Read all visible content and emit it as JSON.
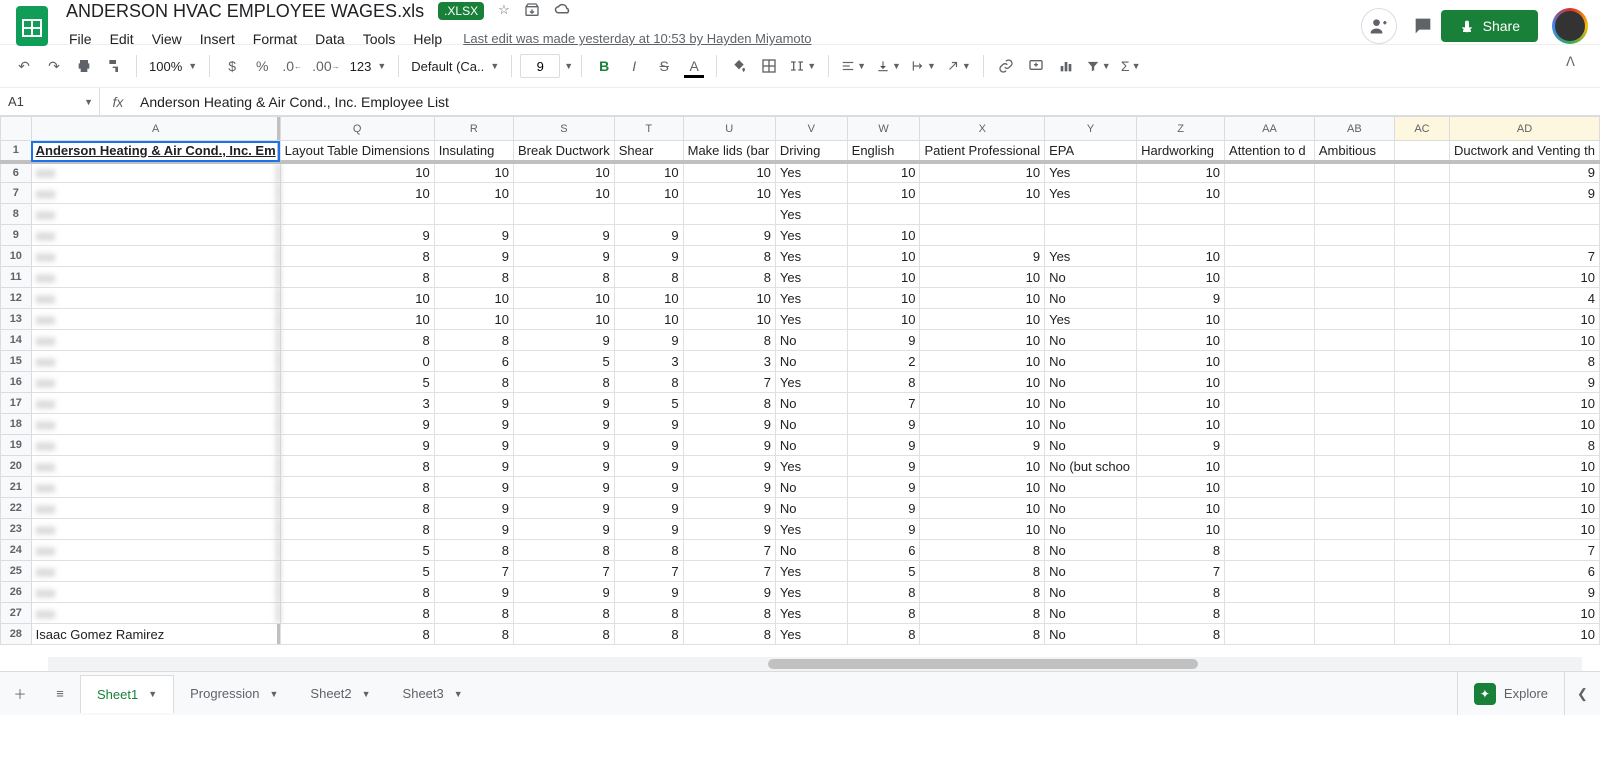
{
  "doc": {
    "title": "ANDERSON HVAC EMPLOYEE WAGES.xls",
    "badge": ".XLSX",
    "lastEdit": "Last edit was made yesterday at 10:53 by Hayden Miyamoto"
  },
  "menu": [
    "File",
    "Edit",
    "View",
    "Insert",
    "Format",
    "Data",
    "Tools",
    "Help"
  ],
  "toolbar": {
    "zoom": "100%",
    "numfmt": "123",
    "font": "Default (Ca...",
    "size": "9"
  },
  "share": "Share",
  "fx": {
    "namebox": "A1",
    "formula": "Anderson Heating & Air Cond., Inc. Employee List"
  },
  "cols": [
    {
      "letter": "A",
      "label": "Anderson Heating & Air Cond., Inc. Em",
      "cls": "frozen-a",
      "hcls": "head1"
    },
    {
      "letter": "Q",
      "label": "Layout Table Dimensions"
    },
    {
      "letter": "R",
      "label": "Insulating"
    },
    {
      "letter": "S",
      "label": "Break Ductwork"
    },
    {
      "letter": "T",
      "label": "Shear"
    },
    {
      "letter": "U",
      "label": "Make lids (bar"
    },
    {
      "letter": "V",
      "label": "Driving",
      "align": "txt"
    },
    {
      "letter": "W",
      "label": "English"
    },
    {
      "letter": "X",
      "label": "Patient Professional"
    },
    {
      "letter": "Y",
      "label": "EPA",
      "align": "txt"
    },
    {
      "letter": "Z",
      "label": "Hardworking"
    },
    {
      "letter": "AA",
      "label": "Attention to d"
    },
    {
      "letter": "AB",
      "label": "Ambitious"
    },
    {
      "letter": "AC",
      "label": "",
      "hl": true
    },
    {
      "letter": "AD",
      "label": "Ductwork and Venting th",
      "hl": true
    }
  ],
  "rows": [
    {
      "n": 6,
      "name": "xxx",
      "v": {
        "Q": 10,
        "R": 10,
        "S": 10,
        "T": 10,
        "U": 10,
        "V": "Yes",
        "W": 10,
        "X": 10,
        "Y": "Yes",
        "Z": 10,
        "AD": 9
      }
    },
    {
      "n": 7,
      "name": "xxx",
      "v": {
        "Q": 10,
        "R": 10,
        "S": 10,
        "T": 10,
        "U": 10,
        "V": "Yes",
        "W": 10,
        "X": 10,
        "Y": "Yes",
        "Z": 10,
        "AD": 9
      }
    },
    {
      "n": 8,
      "name": "xxx",
      "v": {
        "V": "Yes"
      }
    },
    {
      "n": 9,
      "name": "xxx",
      "v": {
        "Q": 9,
        "R": 9,
        "S": 9,
        "T": 9,
        "U": 9,
        "V": "Yes",
        "W": 10
      }
    },
    {
      "n": 10,
      "name": "xxx",
      "v": {
        "Q": 8,
        "R": 9,
        "S": 9,
        "T": 9,
        "U": 8,
        "V": "Yes",
        "W": 10,
        "X": 9,
        "Y": "Yes",
        "Z": 10,
        "AD": 7
      }
    },
    {
      "n": 11,
      "name": "xxx",
      "v": {
        "Q": 8,
        "R": 8,
        "S": 8,
        "T": 8,
        "U": 8,
        "V": "Yes",
        "W": 10,
        "X": 10,
        "Y": "No",
        "Z": 10,
        "AD": 10
      }
    },
    {
      "n": 12,
      "name": "xxx",
      "v": {
        "Q": 10,
        "R": 10,
        "S": 10,
        "T": 10,
        "U": 10,
        "V": "Yes",
        "W": 10,
        "X": 10,
        "Y": "No",
        "Z": 9,
        "AD": 4
      }
    },
    {
      "n": 13,
      "name": "xxx",
      "v": {
        "Q": 10,
        "R": 10,
        "S": 10,
        "T": 10,
        "U": 10,
        "V": "Yes",
        "W": 10,
        "X": 10,
        "Y": "Yes",
        "Z": 10,
        "AD": 10
      }
    },
    {
      "n": 14,
      "name": "xxx",
      "v": {
        "Q": 8,
        "R": 8,
        "S": 9,
        "T": 9,
        "U": 8,
        "V": "No",
        "W": 9,
        "X": 10,
        "Y": "No",
        "Z": 10,
        "AD": 10
      }
    },
    {
      "n": 15,
      "name": "xxx",
      "v": {
        "Q": 0,
        "R": 6,
        "S": 5,
        "T": 3,
        "U": 3,
        "V": "No",
        "W": 2,
        "X": 10,
        "Y": "No",
        "Z": 10,
        "AD": 8
      }
    },
    {
      "n": 16,
      "name": "xxx",
      "v": {
        "Q": 5,
        "R": 8,
        "S": 8,
        "T": 8,
        "U": 7,
        "V": "Yes",
        "W": 8,
        "X": 10,
        "Y": "No",
        "Z": 10,
        "AD": 9
      }
    },
    {
      "n": 17,
      "name": "xxx",
      "v": {
        "Q": 3,
        "R": 9,
        "S": 9,
        "T": 5,
        "U": 8,
        "V": "No",
        "W": 7,
        "X": 10,
        "Y": "No",
        "Z": 10,
        "AD": 10
      }
    },
    {
      "n": 18,
      "name": "xxx",
      "v": {
        "Q": 9,
        "R": 9,
        "S": 9,
        "T": 9,
        "U": 9,
        "V": "No",
        "W": 9,
        "X": 10,
        "Y": "No",
        "Z": 10,
        "AD": 10
      }
    },
    {
      "n": 19,
      "name": "xxx",
      "v": {
        "Q": 9,
        "R": 9,
        "S": 9,
        "T": 9,
        "U": 9,
        "V": "No",
        "W": 9,
        "X": 9,
        "Y": "No",
        "Z": 9,
        "AD": 8
      }
    },
    {
      "n": 20,
      "name": "xxx",
      "v": {
        "Q": 8,
        "R": 9,
        "S": 9,
        "T": 9,
        "U": 9,
        "V": "Yes",
        "W": 9,
        "X": 10,
        "Y": "No (but schoo",
        "Z": 10,
        "AD": 10
      }
    },
    {
      "n": 21,
      "name": "xxx",
      "v": {
        "Q": 8,
        "R": 9,
        "S": 9,
        "T": 9,
        "U": 9,
        "V": "No",
        "W": 9,
        "X": 10,
        "Y": "No",
        "Z": 10,
        "AD": 10
      }
    },
    {
      "n": 22,
      "name": "xxx",
      "v": {
        "Q": 8,
        "R": 9,
        "S": 9,
        "T": 9,
        "U": 9,
        "V": "No",
        "W": 9,
        "X": 10,
        "Y": "No",
        "Z": 10,
        "AD": 10
      }
    },
    {
      "n": 23,
      "name": "xxx",
      "v": {
        "Q": 8,
        "R": 9,
        "S": 9,
        "T": 9,
        "U": 9,
        "V": "Yes",
        "W": 9,
        "X": 10,
        "Y": "No",
        "Z": 10,
        "AD": 10
      }
    },
    {
      "n": 24,
      "name": "xxx",
      "v": {
        "Q": 5,
        "R": 8,
        "S": 8,
        "T": 8,
        "U": 7,
        "V": "No",
        "W": 6,
        "X": 8,
        "Y": "No",
        "Z": 8,
        "AD": 7
      }
    },
    {
      "n": 25,
      "name": "xxx",
      "v": {
        "Q": 5,
        "R": 7,
        "S": 7,
        "T": 7,
        "U": 7,
        "V": "Yes",
        "W": 5,
        "X": 8,
        "Y": "No",
        "Z": 7,
        "AD": 6
      }
    },
    {
      "n": 26,
      "name": "xxx",
      "v": {
        "Q": 8,
        "R": 9,
        "S": 9,
        "T": 9,
        "U": 9,
        "V": "Yes",
        "W": 8,
        "X": 8,
        "Y": "No",
        "Z": 8,
        "AD": 9
      }
    },
    {
      "n": 27,
      "name": "xxx",
      "v": {
        "Q": 8,
        "R": 8,
        "S": 8,
        "T": 8,
        "U": 8,
        "V": "Yes",
        "W": 8,
        "X": 8,
        "Y": "No",
        "Z": 8,
        "AD": 10
      }
    },
    {
      "n": 28,
      "name": "Isaac Gomez Ramirez",
      "noblur": true,
      "v": {
        "Q": 8,
        "R": 8,
        "S": 8,
        "T": 8,
        "U": 8,
        "V": "Yes",
        "W": 8,
        "X": 8,
        "Y": "No",
        "Z": 8,
        "AD": 10
      }
    }
  ],
  "tabs": [
    {
      "label": "Sheet1",
      "active": true
    },
    {
      "label": "Progression"
    },
    {
      "label": "Sheet2"
    },
    {
      "label": "Sheet3"
    }
  ],
  "explore": "Explore"
}
